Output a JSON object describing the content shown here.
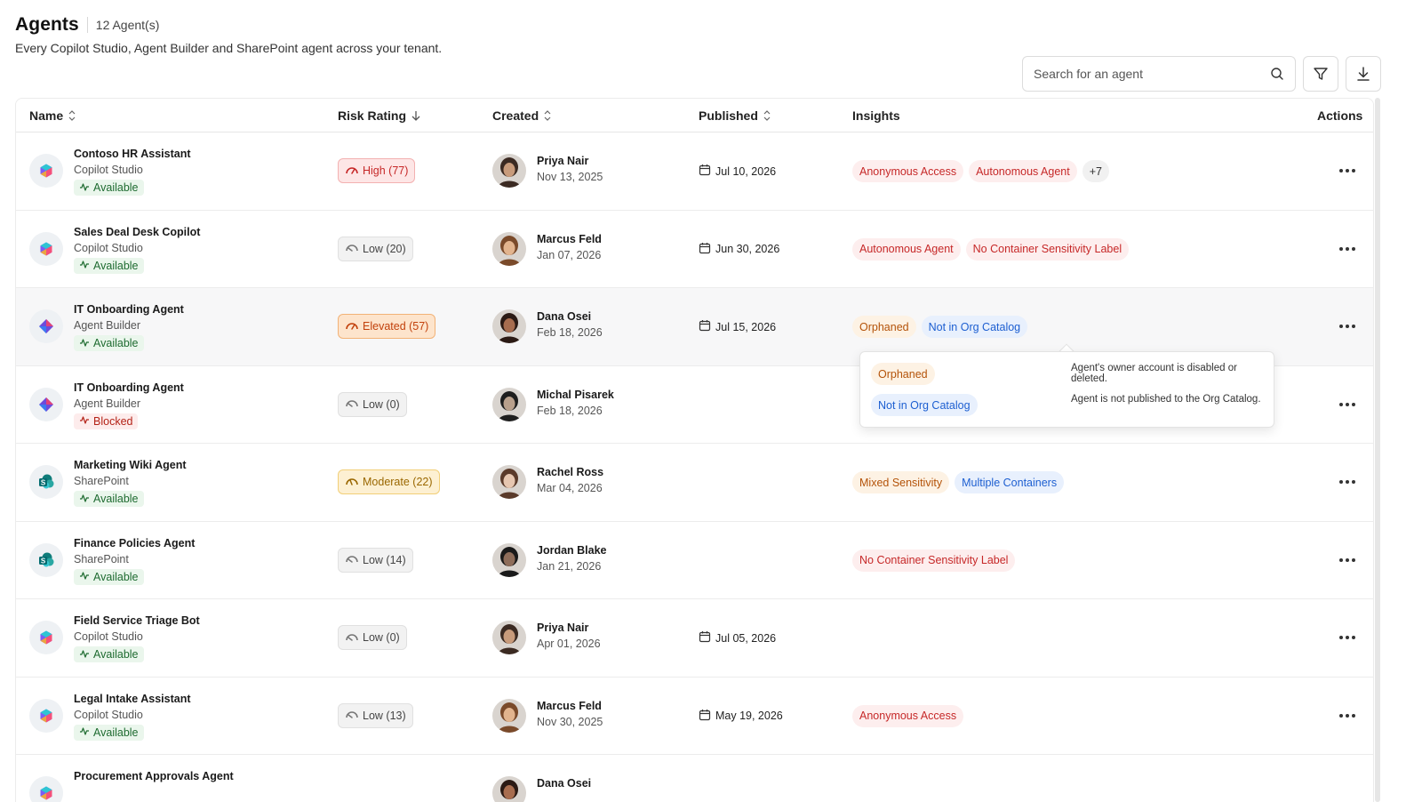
{
  "header": {
    "title": "Agents",
    "count": "12 Agent(s)",
    "subtitle": "Every Copilot Studio, Agent Builder and SharePoint agent across your tenant."
  },
  "search": {
    "placeholder": "Search for an agent"
  },
  "columns": {
    "name": "Name",
    "risk": "Risk Rating",
    "created": "Created",
    "published": "Published",
    "insights": "Insights",
    "actions": "Actions"
  },
  "rows": [
    {
      "name": "Contoso HR Assistant",
      "source": "Copilot Studio",
      "status": "Available",
      "risk": "High (77)",
      "creator": "Priya Nair",
      "created": "Nov 13, 2025",
      "published": "Jul 10, 2026",
      "insights": [
        "Anonymous Access",
        "Autonomous Agent",
        "+7"
      ]
    },
    {
      "name": "Sales Deal Desk Copilot",
      "source": "Copilot Studio",
      "status": "Available",
      "risk": "Low (20)",
      "creator": "Marcus Feld",
      "created": "Jan 07, 2026",
      "published": "Jun 30, 2026",
      "insights": [
        "Autonomous Agent",
        "No Container Sensitivity Label"
      ]
    },
    {
      "name": "IT Onboarding Agent",
      "source": "Agent Builder",
      "status": "Available",
      "risk": "Elevated (57)",
      "creator": "Dana Osei",
      "created": "Feb 18, 2026",
      "published": "Jul 15, 2026",
      "insights": [
        "Orphaned",
        "Not in Org Catalog"
      ]
    },
    {
      "name": "IT Onboarding Agent",
      "source": "Agent Builder",
      "status": "Blocked",
      "risk": "Low (0)",
      "creator": "Michal Pisarek",
      "created": "Feb 18, 2026",
      "published": "",
      "insights": []
    },
    {
      "name": "Marketing Wiki Agent",
      "source": "SharePoint",
      "status": "Available",
      "risk": "Moderate (22)",
      "creator": "Rachel Ross",
      "created": "Mar 04, 2026",
      "published": "",
      "insights": [
        "Mixed Sensitivity",
        "Multiple Containers"
      ]
    },
    {
      "name": "Finance Policies Agent",
      "source": "SharePoint",
      "status": "Available",
      "risk": "Low (14)",
      "creator": "Jordan Blake",
      "created": "Jan 21, 2026",
      "published": "",
      "insights": [
        "No Container Sensitivity Label"
      ]
    },
    {
      "name": "Field Service Triage Bot",
      "source": "Copilot Studio",
      "status": "Available",
      "risk": "Low (0)",
      "creator": "Priya Nair",
      "created": "Apr 01, 2026",
      "published": "Jul 05, 2026",
      "insights": []
    },
    {
      "name": "Legal Intake Assistant",
      "source": "Copilot Studio",
      "status": "Available",
      "risk": "Low (13)",
      "creator": "Marcus Feld",
      "created": "Nov 30, 2025",
      "published": "May 19, 2026",
      "insights": [
        "Anonymous Access"
      ]
    },
    {
      "name": "Procurement Approvals Agent",
      "source": "",
      "status": "",
      "risk": "",
      "creator": "Dana Osei",
      "created": "",
      "published": "",
      "insights": []
    }
  ],
  "popover": {
    "items": [
      {
        "chip": "Orphaned",
        "desc": "Agent's owner account is disabled or deleted."
      },
      {
        "chip": "Not in Org Catalog",
        "desc": "Agent is not published to the Org Catalog."
      }
    ]
  },
  "colors": {
    "risk_high": "#c62828",
    "risk_elevated": "#c2410c",
    "risk_moderate": "#9a6700",
    "status_available": "#1e6b30",
    "status_blocked": "#b42318",
    "insight_blue": "#1d5fd1"
  }
}
